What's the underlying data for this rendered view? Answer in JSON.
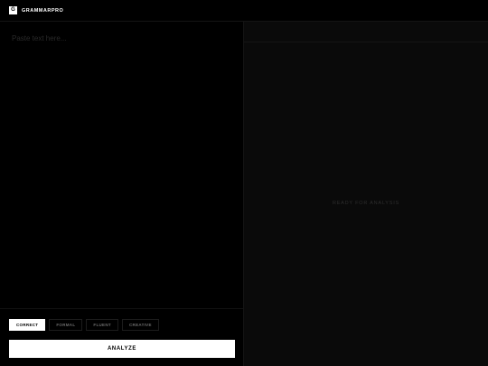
{
  "header": {
    "logo_letter": "G",
    "brand": "GRAMMARPRO"
  },
  "editor": {
    "placeholder": "Paste text here...",
    "value": "",
    "modes": [
      {
        "label": "CORRECT",
        "active": true
      },
      {
        "label": "FORMAL",
        "active": false
      },
      {
        "label": "FLUENT",
        "active": false
      },
      {
        "label": "CREATIVE",
        "active": false
      }
    ],
    "analyze_label": "ANALYZE"
  },
  "results": {
    "empty_state": "READY FOR ANALYSIS"
  }
}
